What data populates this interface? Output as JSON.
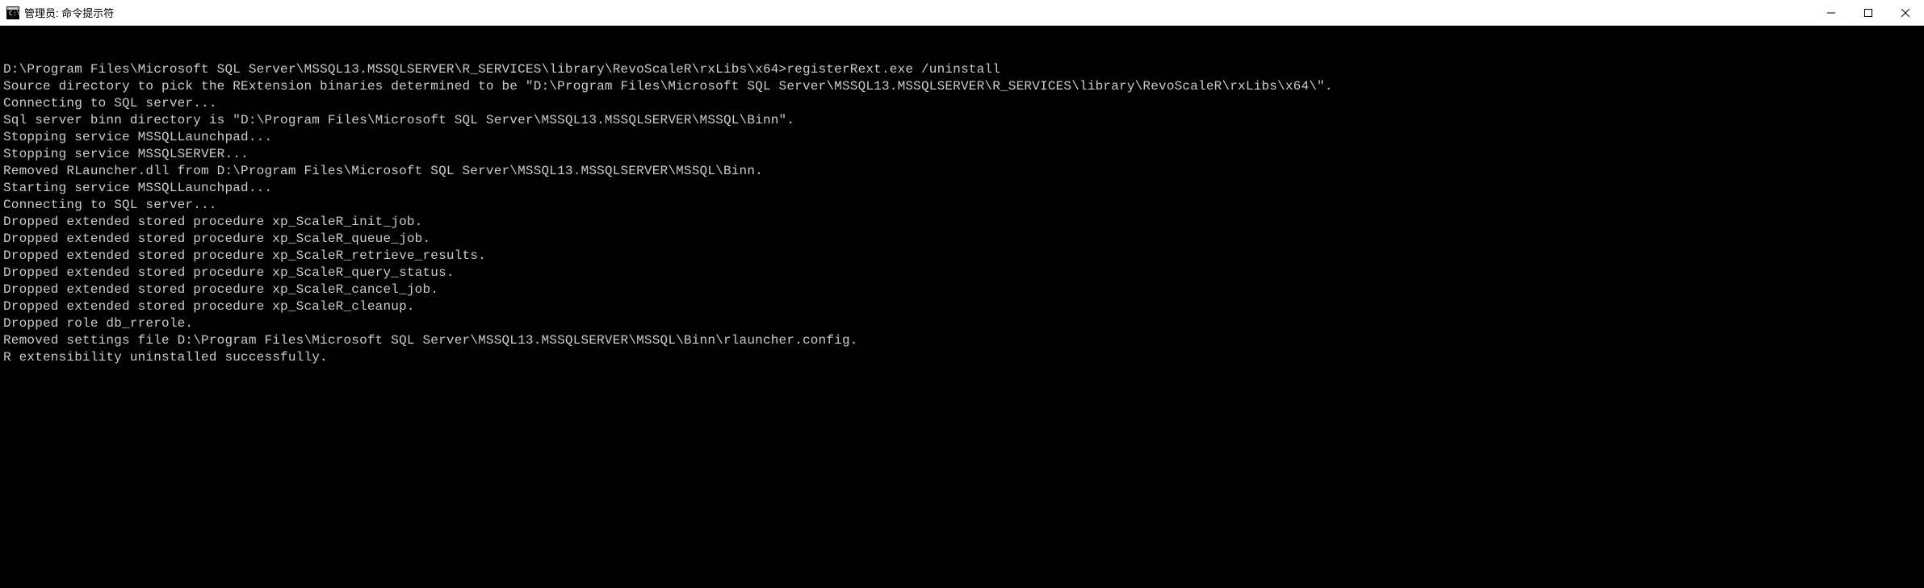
{
  "window": {
    "title": "管理员: 命令提示符"
  },
  "terminal": {
    "prompt_path": "D:\\Program Files\\Microsoft SQL Server\\MSSQL13.MSSQLSERVER\\R_SERVICES\\library\\RevoScaleR\\rxLibs\\x64>",
    "command": "registerRext.exe /uninstall",
    "lines": [
      "Source directory to pick the RExtension binaries determined to be \"D:\\Program Files\\Microsoft SQL Server\\MSSQL13.MSSQLSERVER\\R_SERVICES\\library\\RevoScaleR\\rxLibs\\x64\\\".",
      "Connecting to SQL server...",
      "Sql server binn directory is \"D:\\Program Files\\Microsoft SQL Server\\MSSQL13.MSSQLSERVER\\MSSQL\\Binn\".",
      "Stopping service MSSQLLaunchpad...",
      "Stopping service MSSQLSERVER...",
      "Removed RLauncher.dll from D:\\Program Files\\Microsoft SQL Server\\MSSQL13.MSSQLSERVER\\MSSQL\\Binn.",
      "Starting service MSSQLLaunchpad...",
      "Connecting to SQL server...",
      "Dropped extended stored procedure xp_ScaleR_init_job.",
      "Dropped extended stored procedure xp_ScaleR_queue_job.",
      "Dropped extended stored procedure xp_ScaleR_retrieve_results.",
      "Dropped extended stored procedure xp_ScaleR_query_status.",
      "Dropped extended stored procedure xp_ScaleR_cancel_job.",
      "Dropped extended stored procedure xp_ScaleR_cleanup.",
      "Dropped role db_rrerole.",
      "Removed settings file D:\\Program Files\\Microsoft SQL Server\\MSSQL13.MSSQLSERVER\\MSSQL\\Binn\\rlauncher.config.",
      "R extensibility uninstalled successfully."
    ]
  }
}
